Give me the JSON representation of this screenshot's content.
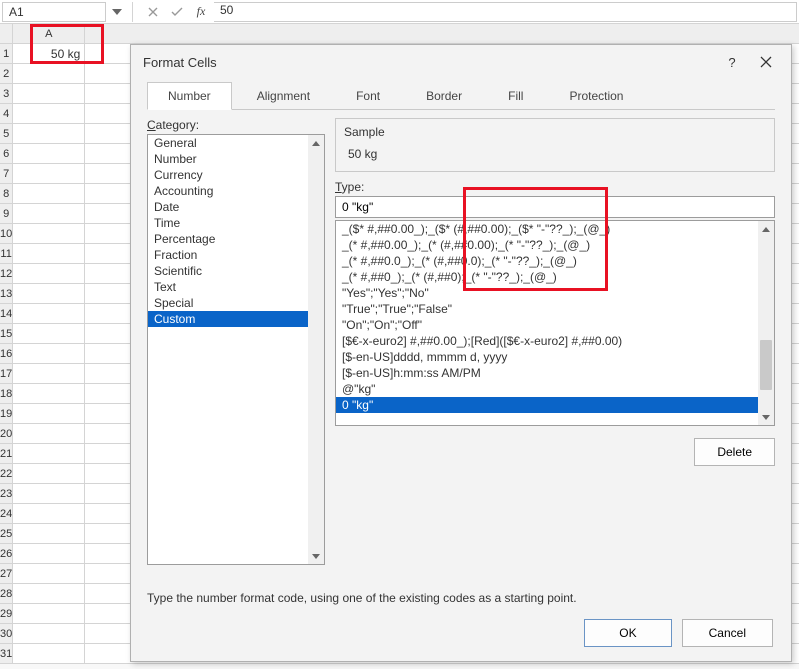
{
  "formula_bar": {
    "name_box": "A1",
    "value": "50"
  },
  "sheet": {
    "col_header_A": "A",
    "cell_A1": "50 kg"
  },
  "dialog": {
    "title": "Format Cells",
    "help": "?",
    "tabs": {
      "number": "Number",
      "alignment": "Alignment",
      "font": "Font",
      "border": "Border",
      "fill": "Fill",
      "protection": "Protection"
    },
    "category_label": "Category:",
    "categories": [
      "General",
      "Number",
      "Currency",
      "Accounting",
      "Date",
      "Time",
      "Percentage",
      "Fraction",
      "Scientific",
      "Text",
      "Special",
      "Custom"
    ],
    "selected_category": "Custom",
    "sample_label": "Sample",
    "sample_value": "50 kg",
    "type_label": "Type:",
    "type_value": "0 \"kg\"",
    "type_list": [
      "_($* #,##0.00_);_($* (#,##0.00);_($* \"-\"??_);_(@_)",
      "_(* #,##0.00_);_(* (#,##0.00);_(* \"-\"??_);_(@_)",
      "_(* #,##0.0_);_(* (#,##0.0);_(* \"-\"??_);_(@_)",
      "_(* #,##0_);_(* (#,##0);_(* \"-\"??_);_(@_)",
      "\"Yes\";\"Yes\";\"No\"",
      "\"True\";\"True\";\"False\"",
      "\"On\";\"On\";\"Off\"",
      "[$€-x-euro2] #,##0.00_);[Red]([$€-x-euro2] #,##0.00)",
      "[$-en-US]dddd, mmmm d, yyyy",
      "[$-en-US]h:mm:ss AM/PM",
      "@\"kg\"",
      "0 \"kg\""
    ],
    "selected_type": "0 \"kg\"",
    "delete_button": "Delete",
    "help_text": "Type the number format code, using one of the existing codes as a starting point.",
    "ok_button": "OK",
    "cancel_button": "Cancel"
  }
}
